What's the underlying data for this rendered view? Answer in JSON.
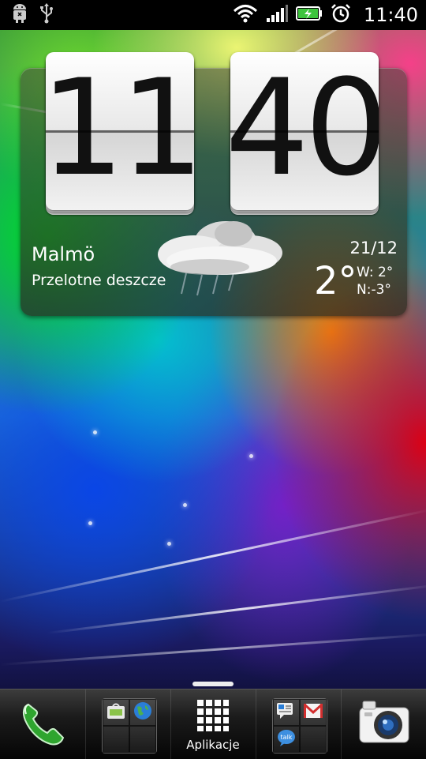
{
  "status_bar": {
    "left_icons": [
      "android-debug-icon",
      "usb-icon"
    ],
    "right_icons": [
      "wifi-icon",
      "signal-icon",
      "battery-charging-icon",
      "alarm-icon"
    ],
    "time": "11:40"
  },
  "clock_widget": {
    "hours": "11",
    "minutes": "40",
    "city": "Malmö",
    "condition": "Przelotne deszcze",
    "date": "21/12",
    "temperature": "2°",
    "high": "W: 2°",
    "low": "N:-3°",
    "weather_icon": "rain-cloud-icon"
  },
  "dock": {
    "phone_icon": "phone-icon",
    "folder_left": [
      "market-icon",
      "browser-globe-icon"
    ],
    "apps_label": "Aplikacje",
    "folder_right": [
      "messages-icon",
      "gmail-icon",
      "talk-icon"
    ],
    "camera_icon": "camera-icon"
  }
}
